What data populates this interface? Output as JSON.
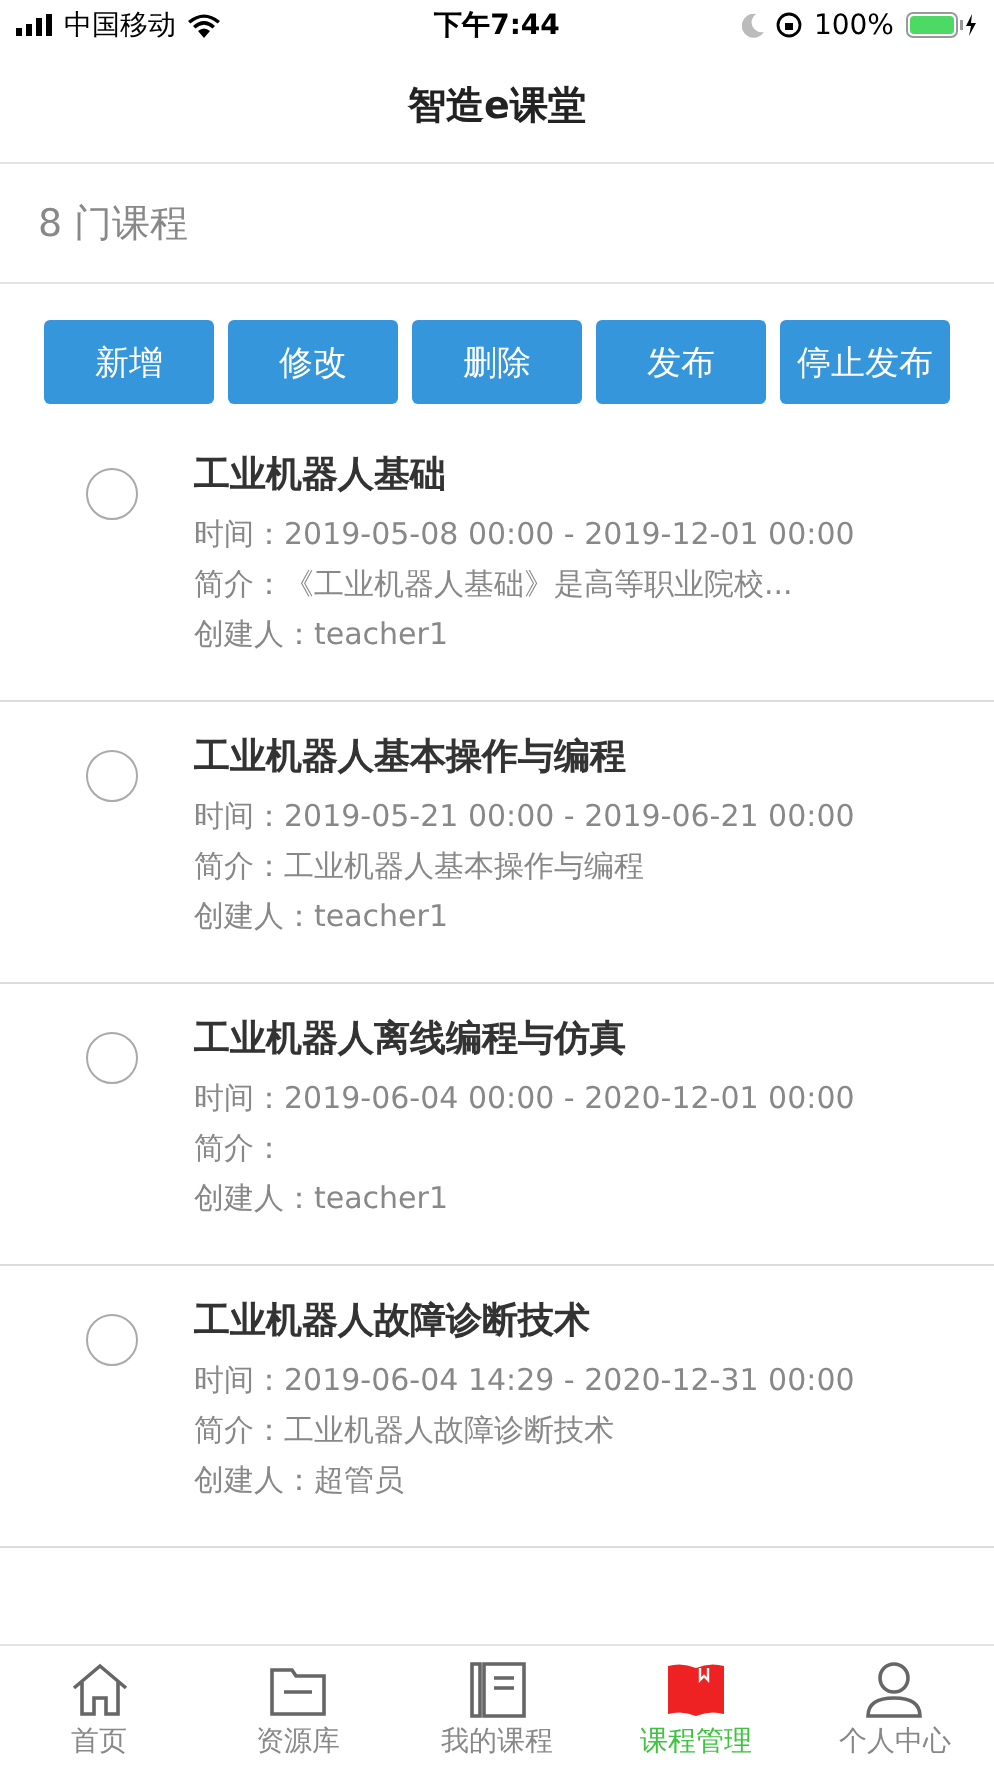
{
  "status_bar": {
    "carrier": "中国移动",
    "time": "下午7:44",
    "battery": "100%"
  },
  "nav_bar": {
    "title": "智造e课堂"
  },
  "course_count": "8 门课程",
  "actions": [
    "新增",
    "修改",
    "删除",
    "发布",
    "停止发布"
  ],
  "courses": [
    {
      "title": "工业机器人基础",
      "time": "时间：2019-05-08 00:00 - 2019-12-01 00:00",
      "intro": "简介：《工业机器人基础》是高等职业院校...",
      "creator": "创建人：teacher1",
      "selected": false
    },
    {
      "title": "工业机器人基本操作与编程",
      "time": "时间：2019-05-21 00:00 - 2019-06-21 00:00",
      "intro": "简介：工业机器人基本操作与编程",
      "creator": "创建人：teacher1",
      "selected": false
    },
    {
      "title": "工业机器人离线编程与仿真",
      "time": "时间：2019-06-04 00:00 - 2020-12-01 00:00",
      "intro": "简介：",
      "creator": "创建人：teacher1",
      "selected": false
    },
    {
      "title": "工业机器人故障诊断技术",
      "time": "时间：2019-06-04 14:29 - 2020-12-31 00:00",
      "intro": "简介：工业机器人故障诊断技术",
      "creator": "创建人：超管员",
      "selected": false
    }
  ],
  "tab_bar": [
    {
      "kind": "home",
      "label": "首页",
      "selected": false
    },
    {
      "kind": "folder",
      "label": "资源库",
      "selected": false
    },
    {
      "kind": "notebook",
      "label": "我的课程",
      "selected": false
    },
    {
      "kind": "book",
      "label": "课程管理",
      "selected": true
    },
    {
      "kind": "person",
      "label": "个人中心",
      "selected": false
    }
  ]
}
